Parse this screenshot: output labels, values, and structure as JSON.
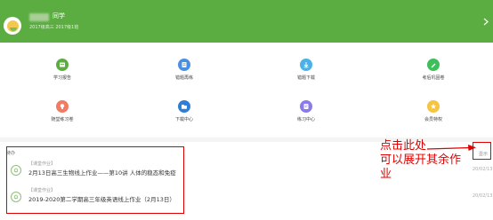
{
  "header": {
    "name_suffix": "同学",
    "sub_info": "2017级高三 2017级1班",
    "bg_color": "#5bad41"
  },
  "grid": [
    {
      "label": "学习报告",
      "icon": "report-icon",
      "color": "#5bad41"
    },
    {
      "label": "错题再练",
      "icon": "wrong-question-icon",
      "color": "#4a90e2"
    },
    {
      "label": "错题下载",
      "icon": "download-icon",
      "color": "#4ab2e6"
    },
    {
      "label": "考后巩固卷",
      "icon": "consolidate-icon",
      "color": "#3dbf5a"
    },
    {
      "label": "随堂练习卷",
      "icon": "lightbulb-icon",
      "color": "#f37a63"
    },
    {
      "label": "下载中心",
      "icon": "folder-icon",
      "color": "#2f7fd8"
    },
    {
      "label": "练习中心",
      "icon": "practice-icon",
      "color": "#8a7be8"
    },
    {
      "label": "会员特权",
      "icon": "star-icon",
      "color": "#f6c344"
    }
  ],
  "tasks_section": {
    "label": "待办",
    "more_label": "显示",
    "items": [
      {
        "tag": "【课堂作业】",
        "title": "2月13日高三生物线上作业——第10讲 人体的稳态和免疫",
        "date": "20/02/13"
      },
      {
        "tag": "【课堂作业】",
        "title": "2019-2020第二学期高三年级英语线上作业（2月13日）",
        "date": "20/02/13"
      }
    ]
  },
  "annotation": {
    "lines": [
      "点击此处",
      "可以展开其余作",
      "业"
    ],
    "color": "#e00000"
  }
}
